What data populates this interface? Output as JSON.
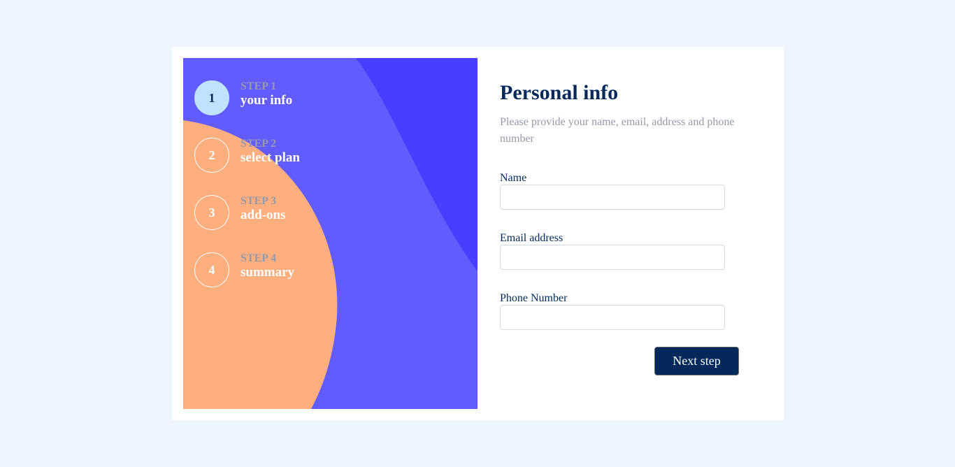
{
  "colors": {
    "page_bg": "#eff5ff",
    "sidebar_bg": "#625cff",
    "sidebar_accent": "#483eff",
    "sidebar_circle": "#ffaf7e",
    "active_step_bg": "#bfe2fd",
    "marine_blue": "#02295a",
    "cool_gray": "#9699ab",
    "border": "#d6d9e6"
  },
  "steps": [
    {
      "number": "1",
      "label": "STEP 1",
      "name": "your info",
      "active": true
    },
    {
      "number": "2",
      "label": "STEP 2",
      "name": "select plan",
      "active": false
    },
    {
      "number": "3",
      "label": "STEP 3",
      "name": "add-ons",
      "active": false
    },
    {
      "number": "4",
      "label": "STEP 4",
      "name": "summary",
      "active": false
    }
  ],
  "form": {
    "title": "Personal info",
    "subtitle": "Please provide your name, email, address and phone number",
    "fields": [
      {
        "label": "Name",
        "value": "",
        "placeholder": ""
      },
      {
        "label": "Email address",
        "value": "",
        "placeholder": ""
      },
      {
        "label": "Phone Number",
        "value": "",
        "placeholder": ""
      }
    ],
    "next_label": "Next step"
  }
}
